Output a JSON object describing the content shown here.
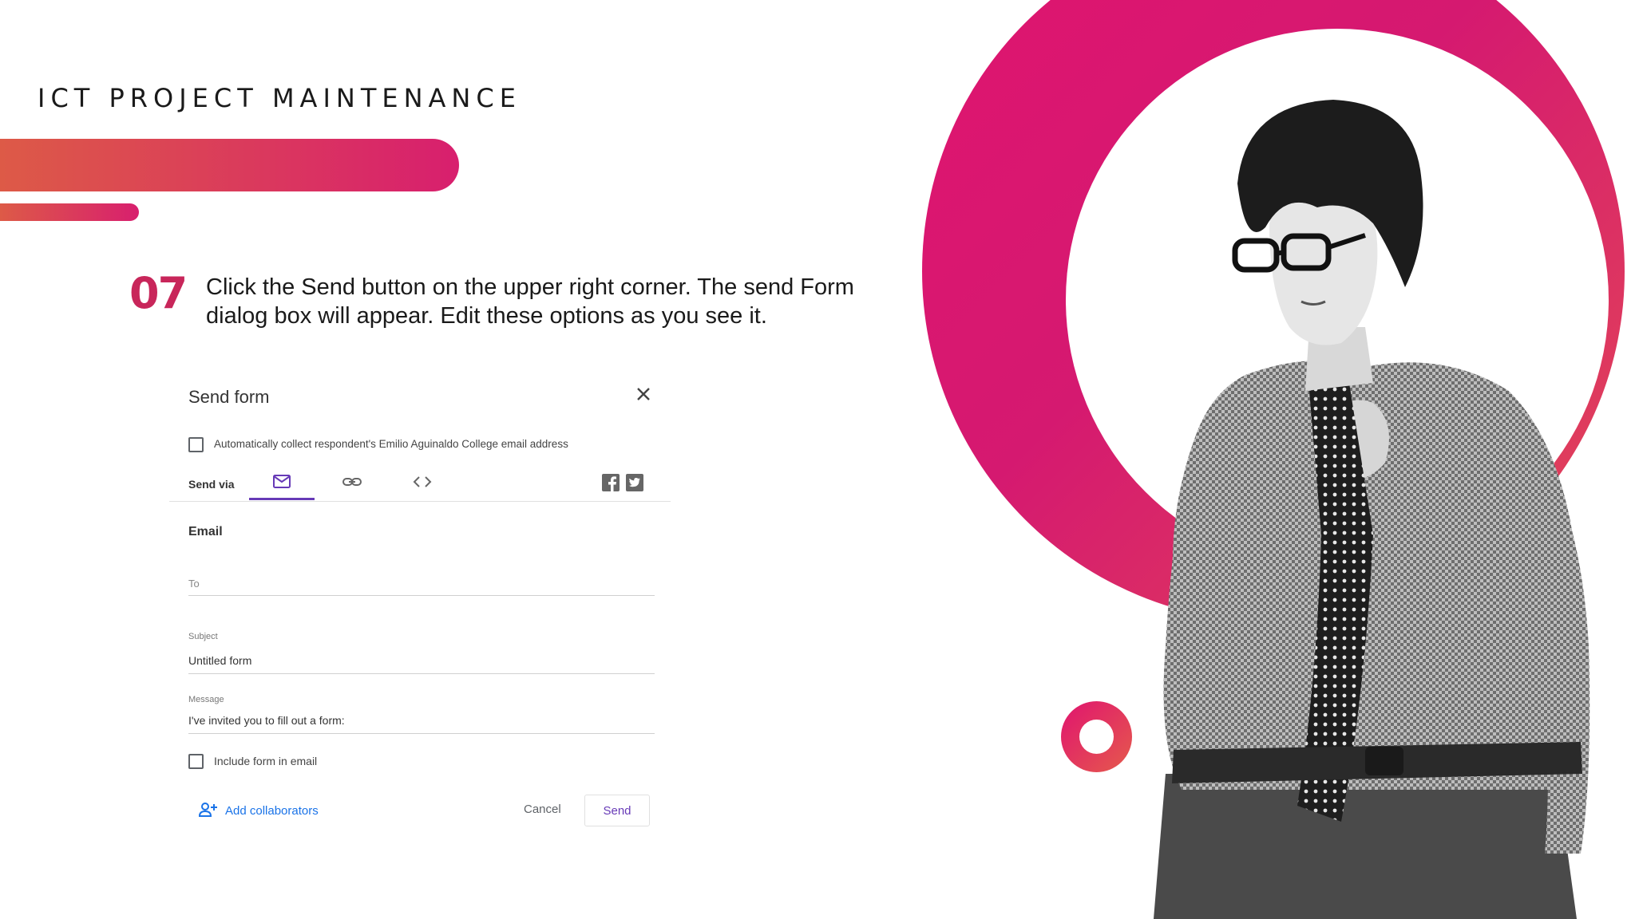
{
  "slide": {
    "title": "ICT PROJECT MAINTENANCE",
    "step_number": "07",
    "step_text": "Click the Send button on the upper right corner. The send Form dialog box will appear. Edit these options as you see it."
  },
  "dialog": {
    "title": "Send form",
    "collect_email_label": "Automatically collect respondent's Emilio Aguinaldo College email address",
    "send_via_label": "Send via",
    "send_via_tabs": [
      "email-icon",
      "link-icon",
      "embed-icon"
    ],
    "social_icons": [
      "facebook-icon",
      "twitter-icon"
    ],
    "section_heading": "Email",
    "to_placeholder": "To",
    "subject_label": "Subject",
    "subject_value": "Untitled form",
    "message_label": "Message",
    "message_value": "I've invited you to fill out a form:",
    "include_form_label": "Include form in email",
    "add_collaborators_label": "Add collaborators",
    "cancel_label": "Cancel",
    "send_label": "Send"
  },
  "colors": {
    "accent_pink": "#d81f6e",
    "accent_orange": "#dd5a47",
    "step_number": "#c8265a",
    "form_purple": "#673ab7",
    "link_blue": "#1a73e8"
  }
}
